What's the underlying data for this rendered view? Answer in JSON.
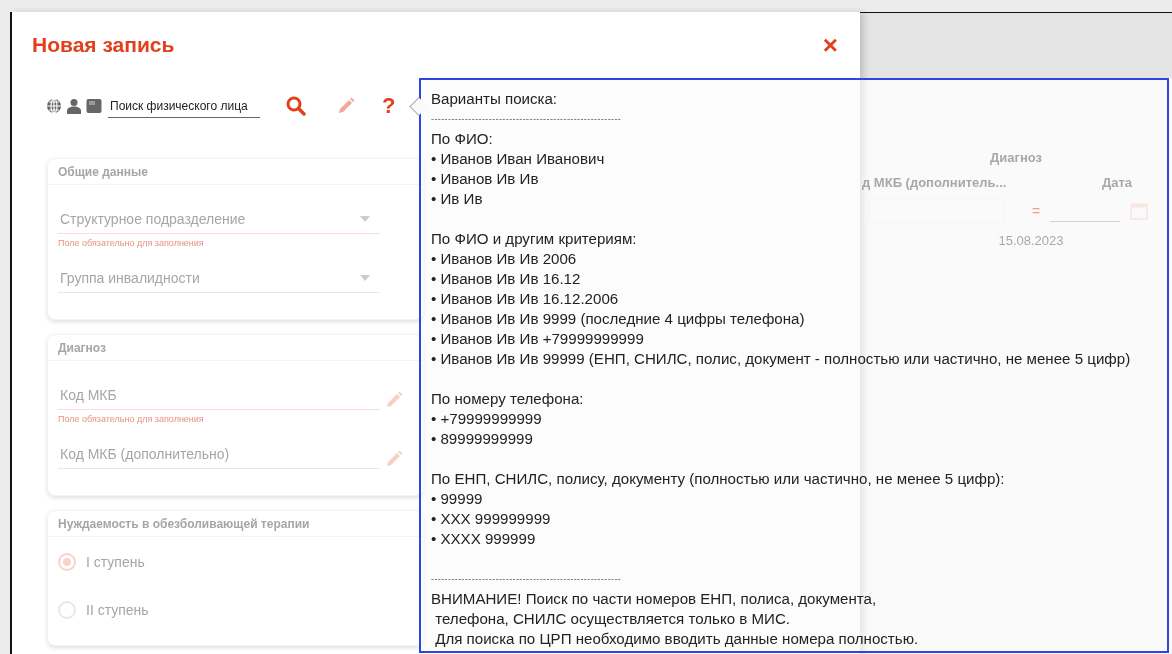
{
  "dialog": {
    "title": "Новая запись",
    "close": "×"
  },
  "search": {
    "value": "Поиск физического лица",
    "help": "?"
  },
  "cards": [
    {
      "title": "Общие данные",
      "kind": "fields",
      "fields": [
        {
          "kind": "select",
          "label": "Структурное подразделение",
          "error": true,
          "hint": "Поле обязательно для заполнения"
        },
        {
          "kind": "select",
          "label": "Группа инвалидности",
          "error": false
        }
      ]
    },
    {
      "title": "Диагноз",
      "kind": "fields",
      "fields": [
        {
          "kind": "code",
          "label": "Код МКБ",
          "error": true,
          "hint": "Поле обязательно для заполнения"
        },
        {
          "kind": "code",
          "label": "Код МКБ (дополнительно)",
          "error": false
        }
      ]
    },
    {
      "title": "Нуждаемость в обезболивающей терапии",
      "kind": "radios",
      "options": [
        {
          "label": "I ступень",
          "selected": true
        },
        {
          "label": "II ступень",
          "selected": false
        }
      ]
    }
  ],
  "background_table": {
    "group_heading": "Диагноз",
    "columns": [
      "д МКБ (дополнитель...",
      "Дата"
    ],
    "operator": "=",
    "date_value": "15.08.2023"
  },
  "tooltip": {
    "title": "Варианты поиска:",
    "rule": "--------------------------------------------------------",
    "sections": [
      {
        "heading": "По ФИО:",
        "items": [
          "• Иванов Иван Иванович",
          "• Иванов Ив Ив",
          "• Ив Ив"
        ]
      },
      {
        "heading": "По ФИО и другим критериям:",
        "items": [
          "• Иванов Ив Ив 2006",
          "• Иванов Ив Ив 16.12",
          "• Иванов Ив Ив 16.12.2006",
          "• Иванов Ив Ив 9999 (последние 4 цифры телефона)",
          "• Иванов Ив Ив +79999999999",
          "• Иванов Ив Ив 99999 (ЕНП, СНИЛС, полис, документ - полностью или частично, не менее 5 цифр)"
        ]
      },
      {
        "heading": "По номеру телефона:",
        "items": [
          "• +79999999999",
          "• 89999999999"
        ]
      },
      {
        "heading": "По ЕНП, СНИЛС, полису, документу (полностью или частично, не менее 5 цифр):",
        "items": [
          "• 99999",
          "• XXX 999999999",
          "• XXXX 999999"
        ]
      }
    ],
    "closing_rule": "--------------------------------------------------------",
    "warning": [
      "ВНИМАНИЕ! Поиск по части номеров ЕНП, полиса, документа,",
      " телефона, СНИЛС осуществляется только в МИС.",
      " Для поиска по ЦРП необходимо вводить данные номера полностью."
    ]
  }
}
